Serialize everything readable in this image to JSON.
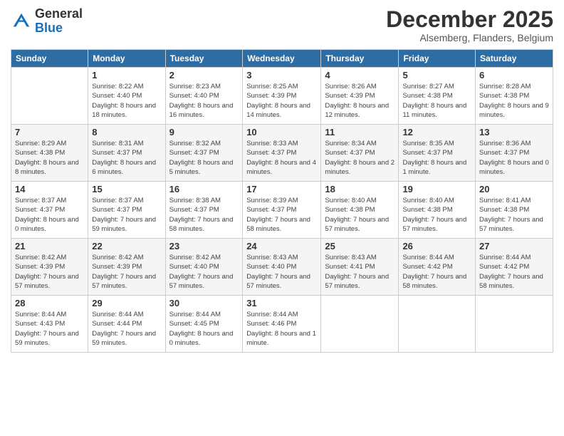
{
  "header": {
    "logo": {
      "general": "General",
      "blue": "Blue"
    },
    "title": "December 2025",
    "location": "Alsemberg, Flanders, Belgium"
  },
  "days_of_week": [
    "Sunday",
    "Monday",
    "Tuesday",
    "Wednesday",
    "Thursday",
    "Friday",
    "Saturday"
  ],
  "weeks": [
    [
      {
        "day": "",
        "info": ""
      },
      {
        "day": "1",
        "info": "Sunrise: 8:22 AM\nSunset: 4:40 PM\nDaylight: 8 hours and 18 minutes."
      },
      {
        "day": "2",
        "info": "Sunrise: 8:23 AM\nSunset: 4:40 PM\nDaylight: 8 hours and 16 minutes."
      },
      {
        "day": "3",
        "info": "Sunrise: 8:25 AM\nSunset: 4:39 PM\nDaylight: 8 hours and 14 minutes."
      },
      {
        "day": "4",
        "info": "Sunrise: 8:26 AM\nSunset: 4:39 PM\nDaylight: 8 hours and 12 minutes."
      },
      {
        "day": "5",
        "info": "Sunrise: 8:27 AM\nSunset: 4:38 PM\nDaylight: 8 hours and 11 minutes."
      },
      {
        "day": "6",
        "info": "Sunrise: 8:28 AM\nSunset: 4:38 PM\nDaylight: 8 hours and 9 minutes."
      }
    ],
    [
      {
        "day": "7",
        "info": "Sunrise: 8:29 AM\nSunset: 4:38 PM\nDaylight: 8 hours and 8 minutes."
      },
      {
        "day": "8",
        "info": "Sunrise: 8:31 AM\nSunset: 4:37 PM\nDaylight: 8 hours and 6 minutes."
      },
      {
        "day": "9",
        "info": "Sunrise: 8:32 AM\nSunset: 4:37 PM\nDaylight: 8 hours and 5 minutes."
      },
      {
        "day": "10",
        "info": "Sunrise: 8:33 AM\nSunset: 4:37 PM\nDaylight: 8 hours and 4 minutes."
      },
      {
        "day": "11",
        "info": "Sunrise: 8:34 AM\nSunset: 4:37 PM\nDaylight: 8 hours and 2 minutes."
      },
      {
        "day": "12",
        "info": "Sunrise: 8:35 AM\nSunset: 4:37 PM\nDaylight: 8 hours and 1 minute."
      },
      {
        "day": "13",
        "info": "Sunrise: 8:36 AM\nSunset: 4:37 PM\nDaylight: 8 hours and 0 minutes."
      }
    ],
    [
      {
        "day": "14",
        "info": "Sunrise: 8:37 AM\nSunset: 4:37 PM\nDaylight: 8 hours and 0 minutes."
      },
      {
        "day": "15",
        "info": "Sunrise: 8:37 AM\nSunset: 4:37 PM\nDaylight: 7 hours and 59 minutes."
      },
      {
        "day": "16",
        "info": "Sunrise: 8:38 AM\nSunset: 4:37 PM\nDaylight: 7 hours and 58 minutes."
      },
      {
        "day": "17",
        "info": "Sunrise: 8:39 AM\nSunset: 4:37 PM\nDaylight: 7 hours and 58 minutes."
      },
      {
        "day": "18",
        "info": "Sunrise: 8:40 AM\nSunset: 4:38 PM\nDaylight: 7 hours and 57 minutes."
      },
      {
        "day": "19",
        "info": "Sunrise: 8:40 AM\nSunset: 4:38 PM\nDaylight: 7 hours and 57 minutes."
      },
      {
        "day": "20",
        "info": "Sunrise: 8:41 AM\nSunset: 4:38 PM\nDaylight: 7 hours and 57 minutes."
      }
    ],
    [
      {
        "day": "21",
        "info": "Sunrise: 8:42 AM\nSunset: 4:39 PM\nDaylight: 7 hours and 57 minutes."
      },
      {
        "day": "22",
        "info": "Sunrise: 8:42 AM\nSunset: 4:39 PM\nDaylight: 7 hours and 57 minutes."
      },
      {
        "day": "23",
        "info": "Sunrise: 8:42 AM\nSunset: 4:40 PM\nDaylight: 7 hours and 57 minutes."
      },
      {
        "day": "24",
        "info": "Sunrise: 8:43 AM\nSunset: 4:40 PM\nDaylight: 7 hours and 57 minutes."
      },
      {
        "day": "25",
        "info": "Sunrise: 8:43 AM\nSunset: 4:41 PM\nDaylight: 7 hours and 57 minutes."
      },
      {
        "day": "26",
        "info": "Sunrise: 8:44 AM\nSunset: 4:42 PM\nDaylight: 7 hours and 58 minutes."
      },
      {
        "day": "27",
        "info": "Sunrise: 8:44 AM\nSunset: 4:42 PM\nDaylight: 7 hours and 58 minutes."
      }
    ],
    [
      {
        "day": "28",
        "info": "Sunrise: 8:44 AM\nSunset: 4:43 PM\nDaylight: 7 hours and 59 minutes."
      },
      {
        "day": "29",
        "info": "Sunrise: 8:44 AM\nSunset: 4:44 PM\nDaylight: 7 hours and 59 minutes."
      },
      {
        "day": "30",
        "info": "Sunrise: 8:44 AM\nSunset: 4:45 PM\nDaylight: 8 hours and 0 minutes."
      },
      {
        "day": "31",
        "info": "Sunrise: 8:44 AM\nSunset: 4:46 PM\nDaylight: 8 hours and 1 minute."
      },
      {
        "day": "",
        "info": ""
      },
      {
        "day": "",
        "info": ""
      },
      {
        "day": "",
        "info": ""
      }
    ]
  ]
}
